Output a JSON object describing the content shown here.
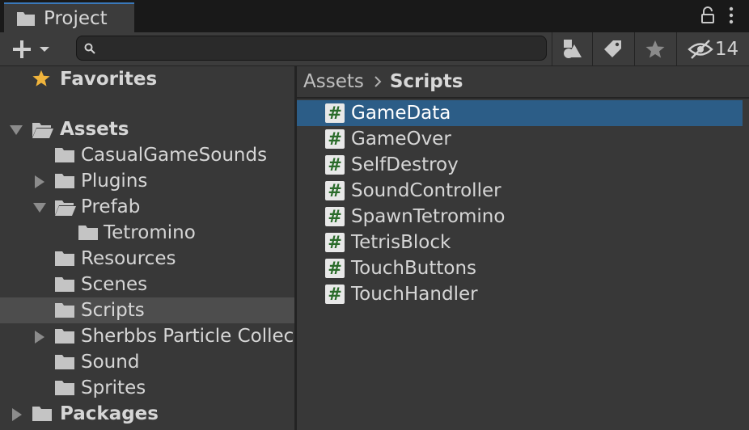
{
  "tab": {
    "title": "Project",
    "icon": "folder-icon"
  },
  "tab_actions": [
    {
      "name": "lock-icon"
    },
    {
      "name": "more-vertical-icon"
    }
  ],
  "toolbar": {
    "create_icon": "plus-icon",
    "search": {
      "value": "",
      "placeholder": "",
      "icon": "search-icon"
    },
    "buttons": [
      {
        "name": "filter-by-type-icon"
      },
      {
        "name": "filter-by-label-icon"
      },
      {
        "name": "favorite-star-icon"
      },
      {
        "name": "hidden-packages-icon",
        "count": "14"
      }
    ]
  },
  "tree": [
    {
      "label": "Favorites",
      "bold": true,
      "icon": "star-icon",
      "arrow": "none"
    },
    {
      "label": "Assets",
      "bold": true,
      "icon": "folder-open-icon",
      "arrow": "expanded"
    },
    {
      "label": "CasualGameSounds",
      "icon": "folder-icon",
      "arrow": "none"
    },
    {
      "label": "Plugins",
      "icon": "folder-icon",
      "arrow": "collapsed"
    },
    {
      "label": "Prefab",
      "icon": "folder-open-icon",
      "arrow": "expanded"
    },
    {
      "label": "Tetromino",
      "icon": "folder-icon",
      "arrow": "none"
    },
    {
      "label": "Resources",
      "icon": "folder-icon",
      "arrow": "none"
    },
    {
      "label": "Scenes",
      "icon": "folder-icon",
      "arrow": "none"
    },
    {
      "label": "Scripts",
      "icon": "folder-icon",
      "arrow": "none",
      "selected": true
    },
    {
      "label": "Sherbbs Particle Collec",
      "icon": "folder-icon",
      "arrow": "collapsed"
    },
    {
      "label": "Sound",
      "icon": "folder-icon",
      "arrow": "none"
    },
    {
      "label": "Sprites",
      "icon": "folder-icon",
      "arrow": "none"
    },
    {
      "label": "Packages",
      "bold": true,
      "icon": "folder-icon",
      "arrow": "collapsed"
    }
  ],
  "breadcrumb": {
    "root": "Assets",
    "separator_icon": "chevron-right-icon",
    "current": "Scripts"
  },
  "files": [
    {
      "label": "GameData",
      "icon": "csharp-script-icon",
      "glyph": "#",
      "selected": true
    },
    {
      "label": "GameOver",
      "icon": "csharp-script-icon",
      "glyph": "#"
    },
    {
      "label": "SelfDestroy",
      "icon": "csharp-script-icon",
      "glyph": "#"
    },
    {
      "label": "SoundController",
      "icon": "csharp-script-icon",
      "glyph": "#"
    },
    {
      "label": "SpawnTetromino",
      "icon": "csharp-script-icon",
      "glyph": "#"
    },
    {
      "label": "TetrisBlock",
      "icon": "csharp-script-icon",
      "glyph": "#"
    },
    {
      "label": "TouchButtons",
      "icon": "csharp-script-icon",
      "glyph": "#"
    },
    {
      "label": "TouchHandler",
      "icon": "csharp-script-icon",
      "glyph": "#"
    }
  ],
  "colors": {
    "selection": "#2c5d87",
    "tab_accent": "#3a79bb",
    "script_glyph": "#2a6b2a",
    "star": "#f0b43c"
  }
}
